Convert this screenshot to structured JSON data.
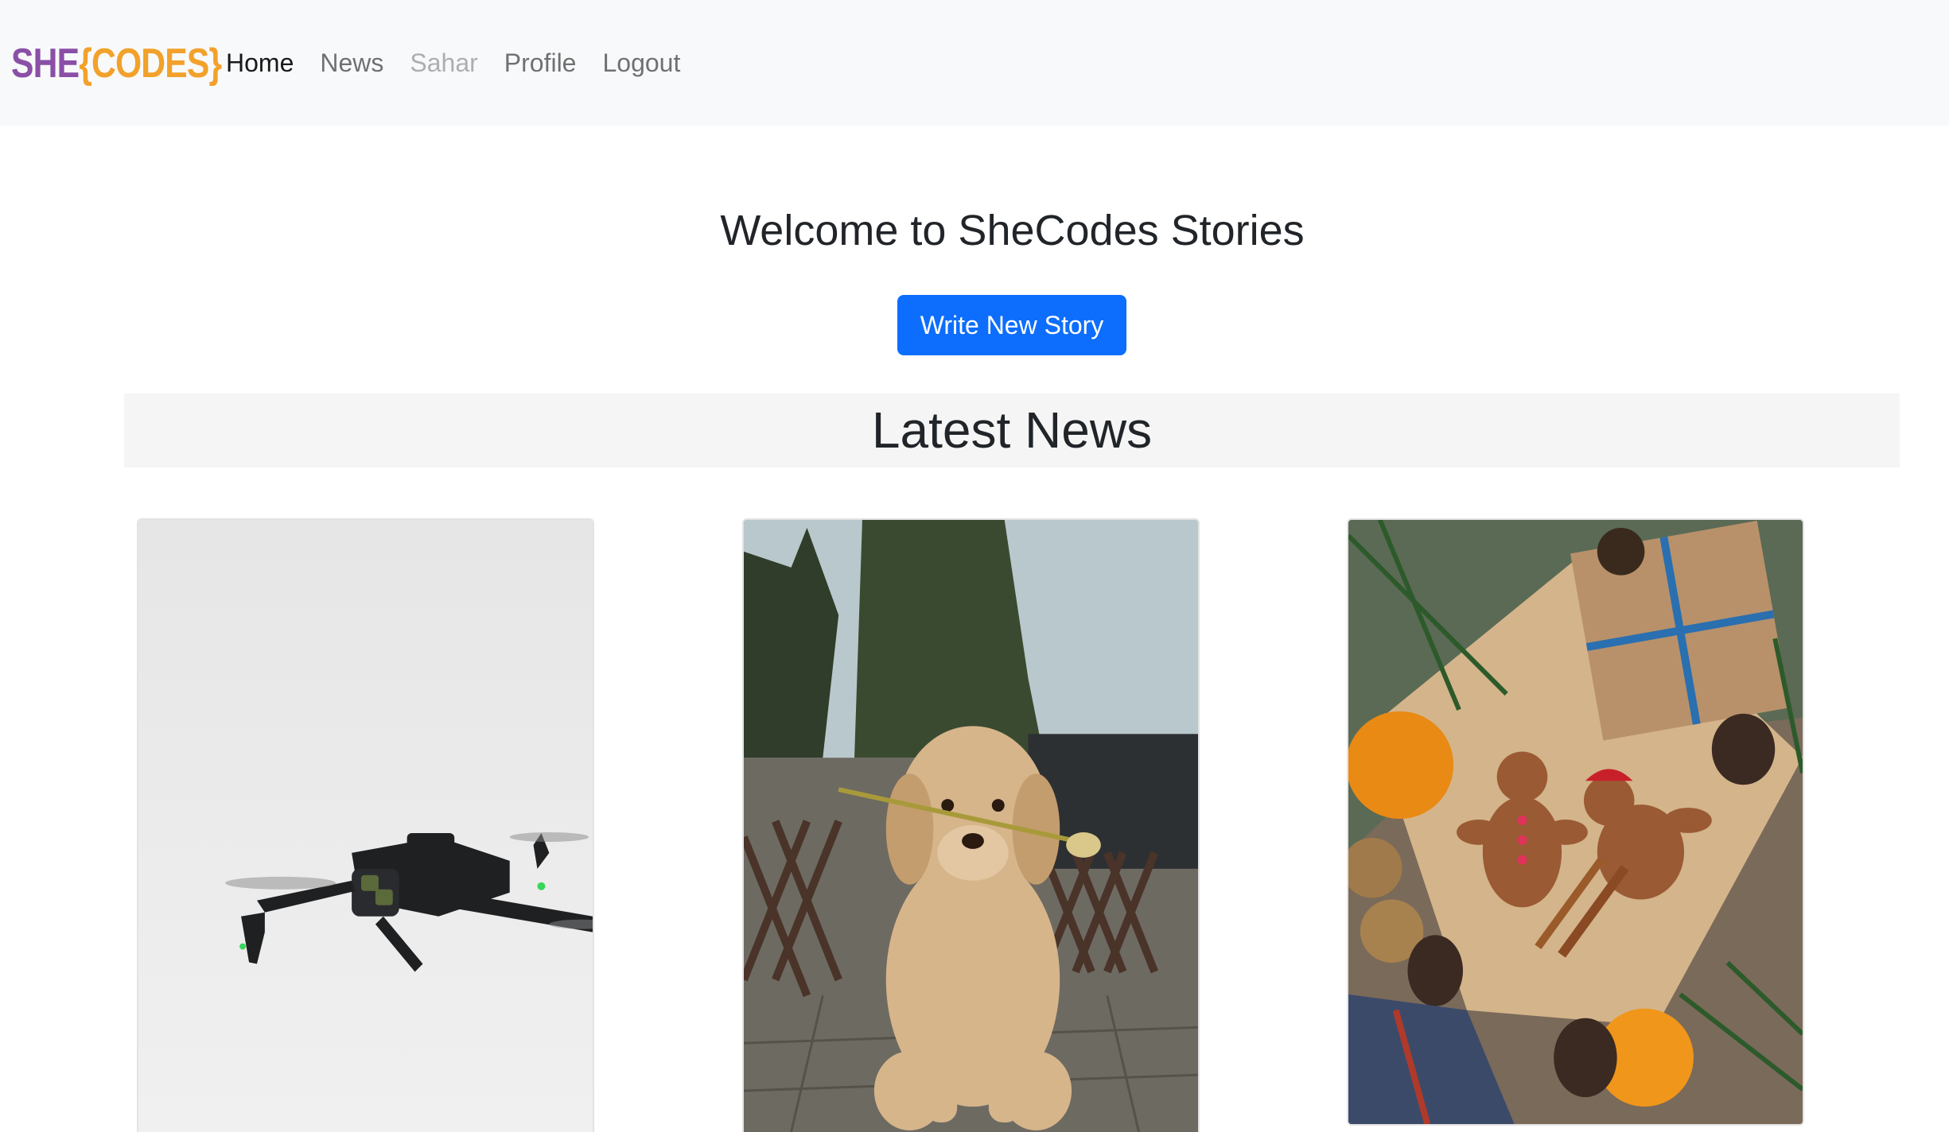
{
  "navbar": {
    "logo": {
      "part1": "SHE",
      "part2": "{CODES}"
    },
    "links": [
      {
        "label": "Home",
        "state": "active"
      },
      {
        "label": "News",
        "state": "normal"
      },
      {
        "label": "Sahar",
        "state": "disabled"
      },
      {
        "label": "Profile",
        "state": "normal"
      },
      {
        "label": "Logout",
        "state": "normal"
      }
    ]
  },
  "main": {
    "heading": "Welcome to SheCodes Stories",
    "write_button_label": "Write New Story",
    "latest_heading": "Latest News"
  },
  "cards": [
    {
      "image": "drone-photo"
    },
    {
      "image": "dog-with-flower-photo"
    },
    {
      "image": "gingerbread-christmas-photo"
    }
  ],
  "colors": {
    "brand_purple": "#8a4fa7",
    "brand_orange": "#f2a12b",
    "primary_button": "#0d6efd",
    "navbar_bg": "#f8f9fa"
  }
}
